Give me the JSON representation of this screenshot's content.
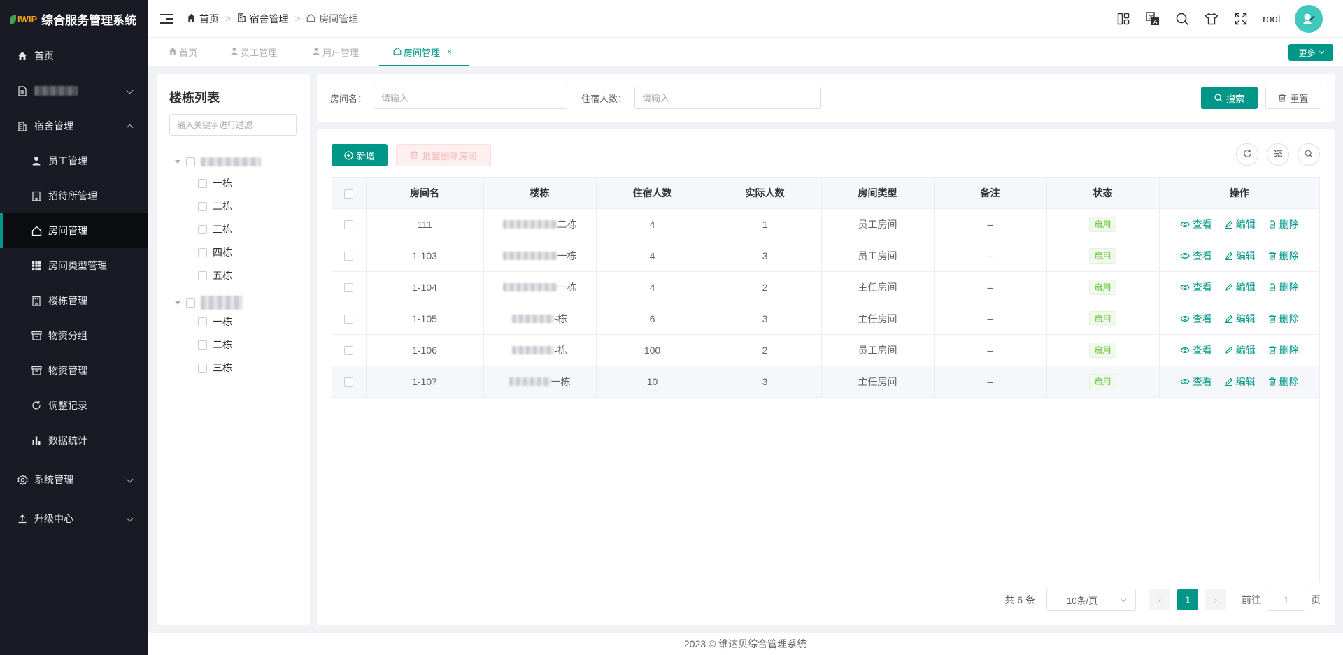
{
  "app": {
    "logo_text": "IWIP",
    "title": "综合服务管理系统"
  },
  "sidebar": {
    "items": [
      {
        "label": "首页",
        "icon": "home-icon"
      },
      {
        "label": "",
        "icon": "document-icon",
        "redacted": true
      },
      {
        "label": "宿舍管理",
        "icon": "building-icon",
        "expanded": true
      },
      {
        "label": "员工管理",
        "icon": "user-icon"
      },
      {
        "label": "招待所管理",
        "icon": "building-icon"
      },
      {
        "label": "房间管理",
        "icon": "house-icon",
        "active": true
      },
      {
        "label": "房间类型管理",
        "icon": "grid-icon"
      },
      {
        "label": "楼栋管理",
        "icon": "building-icon"
      },
      {
        "label": "物资分组",
        "icon": "box-icon"
      },
      {
        "label": "物资管理",
        "icon": "box-icon"
      },
      {
        "label": "调整记录",
        "icon": "refresh-icon"
      },
      {
        "label": "数据统计",
        "icon": "bar-chart-icon"
      },
      {
        "label": "系统管理",
        "icon": "gear-icon"
      },
      {
        "label": "升级中心",
        "icon": "upload-icon"
      }
    ]
  },
  "header": {
    "breadcrumb": [
      "首页",
      "宿舍管理",
      "房间管理"
    ],
    "username": "root"
  },
  "tabs": {
    "items": [
      {
        "label": "首页"
      },
      {
        "label": "员工管理"
      },
      {
        "label": "用户管理"
      },
      {
        "label": "房间管理",
        "active": true
      }
    ],
    "close_label": "×",
    "more_label": "更多"
  },
  "tree": {
    "title": "楼栋列表",
    "filter_placeholder": "输入关键字进行过滤",
    "group1_children": [
      "一栋",
      "二栋",
      "三栋",
      "四栋",
      "五栋"
    ],
    "group2_children": [
      "一栋",
      "二栋",
      "三栋"
    ]
  },
  "search": {
    "room_label": "房间名：",
    "room_placeholder": "请输入",
    "capacity_label": "住宿人数：",
    "capacity_placeholder": "请输入",
    "search_button": "搜索",
    "reset_button": "重置"
  },
  "toolbar": {
    "add_button": "新增",
    "batch_delete_button": "批量删除房间"
  },
  "table": {
    "columns": [
      "房间名",
      "楼栋",
      "住宿人数",
      "实际人数",
      "房间类型",
      "备注",
      "状态",
      "操作"
    ],
    "rows": [
      {
        "room": "111",
        "building": "二栋",
        "capacity": "4",
        "actual": "1",
        "type": "员工房间",
        "note": "--",
        "status": "启用"
      },
      {
        "room": "1-103",
        "building": "一栋",
        "capacity": "4",
        "actual": "3",
        "type": "员工房间",
        "note": "--",
        "status": "启用"
      },
      {
        "room": "1-104",
        "building": "一栋",
        "capacity": "4",
        "actual": "2",
        "type": "主任房间",
        "note": "--",
        "status": "启用"
      },
      {
        "room": "1-105",
        "building": "-栋",
        "capacity": "6",
        "actual": "3",
        "type": "主任房间",
        "note": "--",
        "status": "启用"
      },
      {
        "room": "1-106",
        "building": "-栋",
        "capacity": "100",
        "actual": "2",
        "type": "员工房间",
        "note": "--",
        "status": "启用"
      },
      {
        "room": "1-107",
        "building": "一栋",
        "capacity": "10",
        "actual": "3",
        "type": "主任房间",
        "note": "--",
        "status": "启用"
      }
    ],
    "op_view": "查看",
    "op_edit": "编辑",
    "op_delete": "删除"
  },
  "pagination": {
    "total_text": "共 6 条",
    "page_size": "10条/页",
    "current_page": "1",
    "goto_label": "前往",
    "goto_value": "1",
    "page_suffix": "页"
  },
  "footer": {
    "text": "2023 © 维达贝综合管理系统"
  },
  "colors": {
    "primary": "#009688",
    "sidebar_bg": "#191a23",
    "success": "#67c23a"
  }
}
